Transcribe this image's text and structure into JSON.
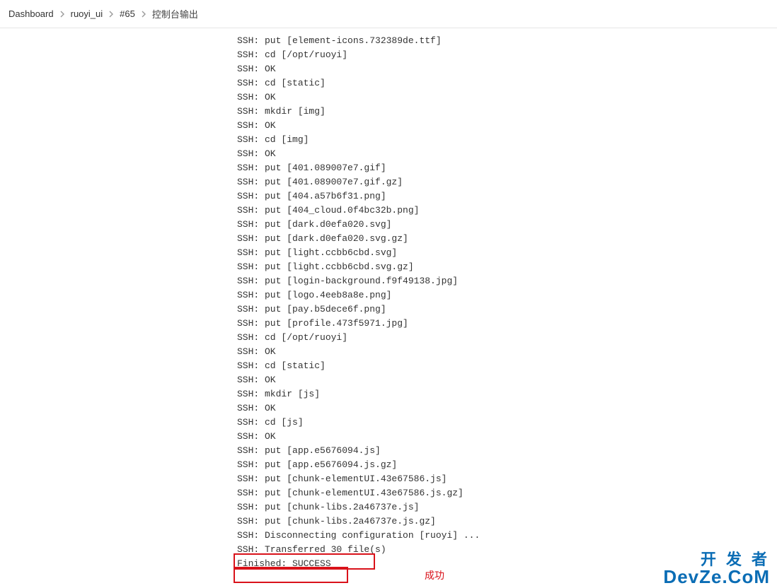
{
  "breadcrumb": {
    "items": [
      {
        "label": "Dashboard"
      },
      {
        "label": "ruoyi_ui"
      },
      {
        "label": "#65"
      },
      {
        "label": "控制台输出"
      }
    ]
  },
  "console": {
    "lines": [
      "SSH: put [element-icons.732389de.ttf]",
      "SSH: cd [/opt/ruoyi]",
      "SSH: OK",
      "SSH: cd [static]",
      "SSH: OK",
      "SSH: mkdir [img]",
      "SSH: OK",
      "SSH: cd [img]",
      "SSH: OK",
      "SSH: put [401.089007e7.gif]",
      "SSH: put [401.089007e7.gif.gz]",
      "SSH: put [404.a57b6f31.png]",
      "SSH: put [404_cloud.0f4bc32b.png]",
      "SSH: put [dark.d0efa020.svg]",
      "SSH: put [dark.d0efa020.svg.gz]",
      "SSH: put [light.ccbb6cbd.svg]",
      "SSH: put [light.ccbb6cbd.svg.gz]",
      "SSH: put [login-background.f9f49138.jpg]",
      "SSH: put [logo.4eeb8a8e.png]",
      "SSH: put [pay.b5dece6f.png]",
      "SSH: put [profile.473f5971.jpg]",
      "SSH: cd [/opt/ruoyi]",
      "SSH: OK",
      "SSH: cd [static]",
      "SSH: OK",
      "SSH: mkdir [js]",
      "SSH: OK",
      "SSH: cd [js]",
      "SSH: OK",
      "SSH: put [app.e5676094.js]",
      "SSH: put [app.e5676094.js.gz]",
      "SSH: put [chunk-elementUI.43e67586.js]",
      "SSH: put [chunk-elementUI.43e67586.js.gz]",
      "SSH: put [chunk-libs.2a46737e.js]",
      "SSH: put [chunk-libs.2a46737e.js.gz]",
      "SSH: Disconnecting configuration [ruoyi] ...",
      "SSH: Transferred 30 file(s)",
      "Finished: SUCCESS"
    ]
  },
  "annotation": {
    "success_label": "成功"
  },
  "watermark": {
    "line1": "开发者",
    "line2": "DevZe.CoM"
  }
}
